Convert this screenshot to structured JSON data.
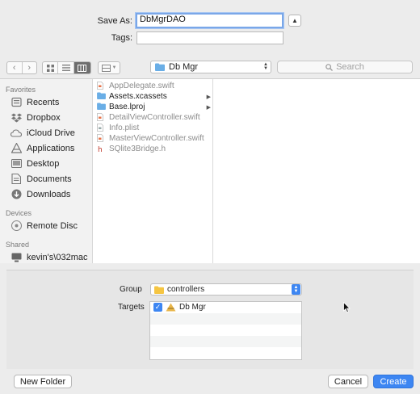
{
  "save_as": {
    "label": "Save As:",
    "value": "DbMgrDAO"
  },
  "tags": {
    "label": "Tags:",
    "value": ""
  },
  "toolbar": {
    "location": "Db Mgr",
    "search_placeholder": "Search"
  },
  "sidebar": {
    "favorites_header": "Favorites",
    "favorites": [
      {
        "label": "Recents",
        "icon": "clock-icon"
      },
      {
        "label": "Dropbox",
        "icon": "dropbox-icon"
      },
      {
        "label": "iCloud Drive",
        "icon": "cloud-icon"
      },
      {
        "label": "Applications",
        "icon": "applications-icon"
      },
      {
        "label": "Desktop",
        "icon": "desktop-icon"
      },
      {
        "label": "Documents",
        "icon": "documents-icon"
      },
      {
        "label": "Downloads",
        "icon": "downloads-icon"
      }
    ],
    "devices_header": "Devices",
    "devices": [
      {
        "label": "Remote Disc",
        "icon": "disc-icon"
      }
    ],
    "shared_header": "Shared",
    "shared": [
      {
        "label": "kevin's\\032mac",
        "icon": "computer-icon"
      }
    ]
  },
  "files": [
    {
      "name": "AppDelegate.swift",
      "kind": "swift",
      "dim": true,
      "folder": false
    },
    {
      "name": "Assets.xcassets",
      "kind": "folder",
      "dim": false,
      "folder": true
    },
    {
      "name": "Base.lproj",
      "kind": "folder",
      "dim": false,
      "folder": true
    },
    {
      "name": "DetailViewController.swift",
      "kind": "swift",
      "dim": true,
      "folder": false
    },
    {
      "name": "Info.plist",
      "kind": "plist",
      "dim": true,
      "folder": false
    },
    {
      "name": "MasterViewController.swift",
      "kind": "swift",
      "dim": true,
      "folder": false
    },
    {
      "name": "SQlite3Bridge.h",
      "kind": "header",
      "dim": true,
      "folder": false
    }
  ],
  "accessory": {
    "group_label": "Group",
    "group_value": "controllers",
    "targets_label": "Targets",
    "targets": [
      {
        "name": "Db Mgr",
        "checked": true
      }
    ]
  },
  "buttons": {
    "new_folder": "New Folder",
    "cancel": "Cancel",
    "create": "Create"
  },
  "colors": {
    "accent": "#3d86f2",
    "folder": "#6aaee6"
  }
}
